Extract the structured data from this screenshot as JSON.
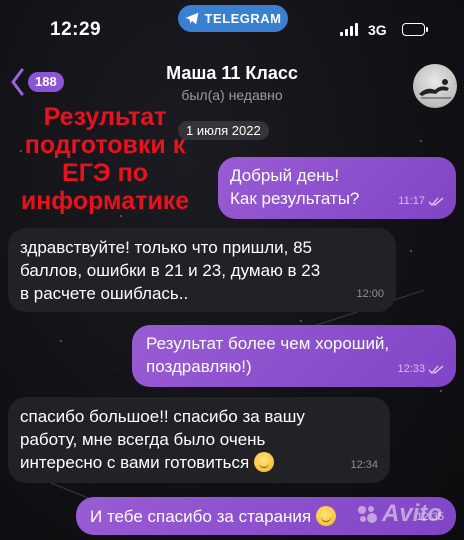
{
  "status_bar": {
    "time": "12:29",
    "app_pill": "TELEGRAM",
    "network": "3G"
  },
  "header": {
    "back_badge": "188",
    "title": "Маша 11 Класс",
    "subtitle": "был(а) недавно"
  },
  "overlay_caption": {
    "line1": "Результат",
    "line2": "подготовки к",
    "line3": "ЕГЭ по",
    "line4": "информатике"
  },
  "date_separator": "1 июля 2022",
  "messages": [
    {
      "direction": "outgoing",
      "lines": [
        "Добрый день!",
        "Как результаты?"
      ],
      "time": "11:17"
    },
    {
      "direction": "incoming",
      "lines": [
        "здравствуйте! только что пришли, 85",
        "баллов, ошибки в 21 и 23, думаю в 23",
        "в расчете ошиблась.."
      ],
      "time": "12:00"
    },
    {
      "direction": "outgoing",
      "lines": [
        "Результат более чем хороший,",
        "поздравляю!)"
      ],
      "time": "12:33"
    },
    {
      "direction": "incoming",
      "lines": [
        "спасибо большое!! спасибо за вашу",
        "работу, мне всегда было очень",
        "интересно с вами готовиться"
      ],
      "time": "12:34"
    },
    {
      "direction": "outgoing",
      "lines": [
        "И тебе спасибо за старания"
      ],
      "time": "12:35"
    }
  ],
  "watermark": "Avito",
  "colors": {
    "outgoing_bubble": "#8a4fcf",
    "incoming_bubble": "#222226",
    "unread_badge": "#8c55d6",
    "telegram_pill": "#3a80d0",
    "caption_red": "#e8121e"
  }
}
